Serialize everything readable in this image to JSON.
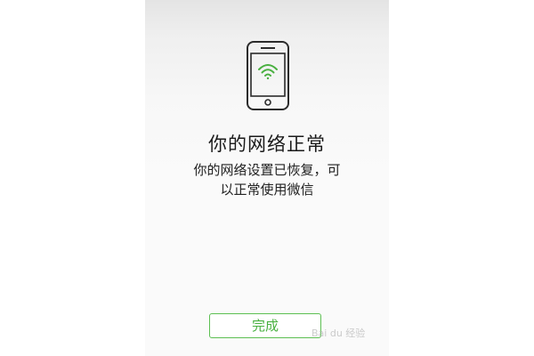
{
  "status": {
    "title": "你的网络正常",
    "message_line1": "你的网络设置已恢复，可",
    "message_line2": "以正常使用微信"
  },
  "icons": {
    "phone": "phone-icon",
    "wifi": "wifi-icon"
  },
  "actions": {
    "done_label": "完成"
  },
  "watermark": {
    "text": "Bai du 经验"
  },
  "colors": {
    "accent_green": "#49b040",
    "button_border": "#5cbf52"
  }
}
